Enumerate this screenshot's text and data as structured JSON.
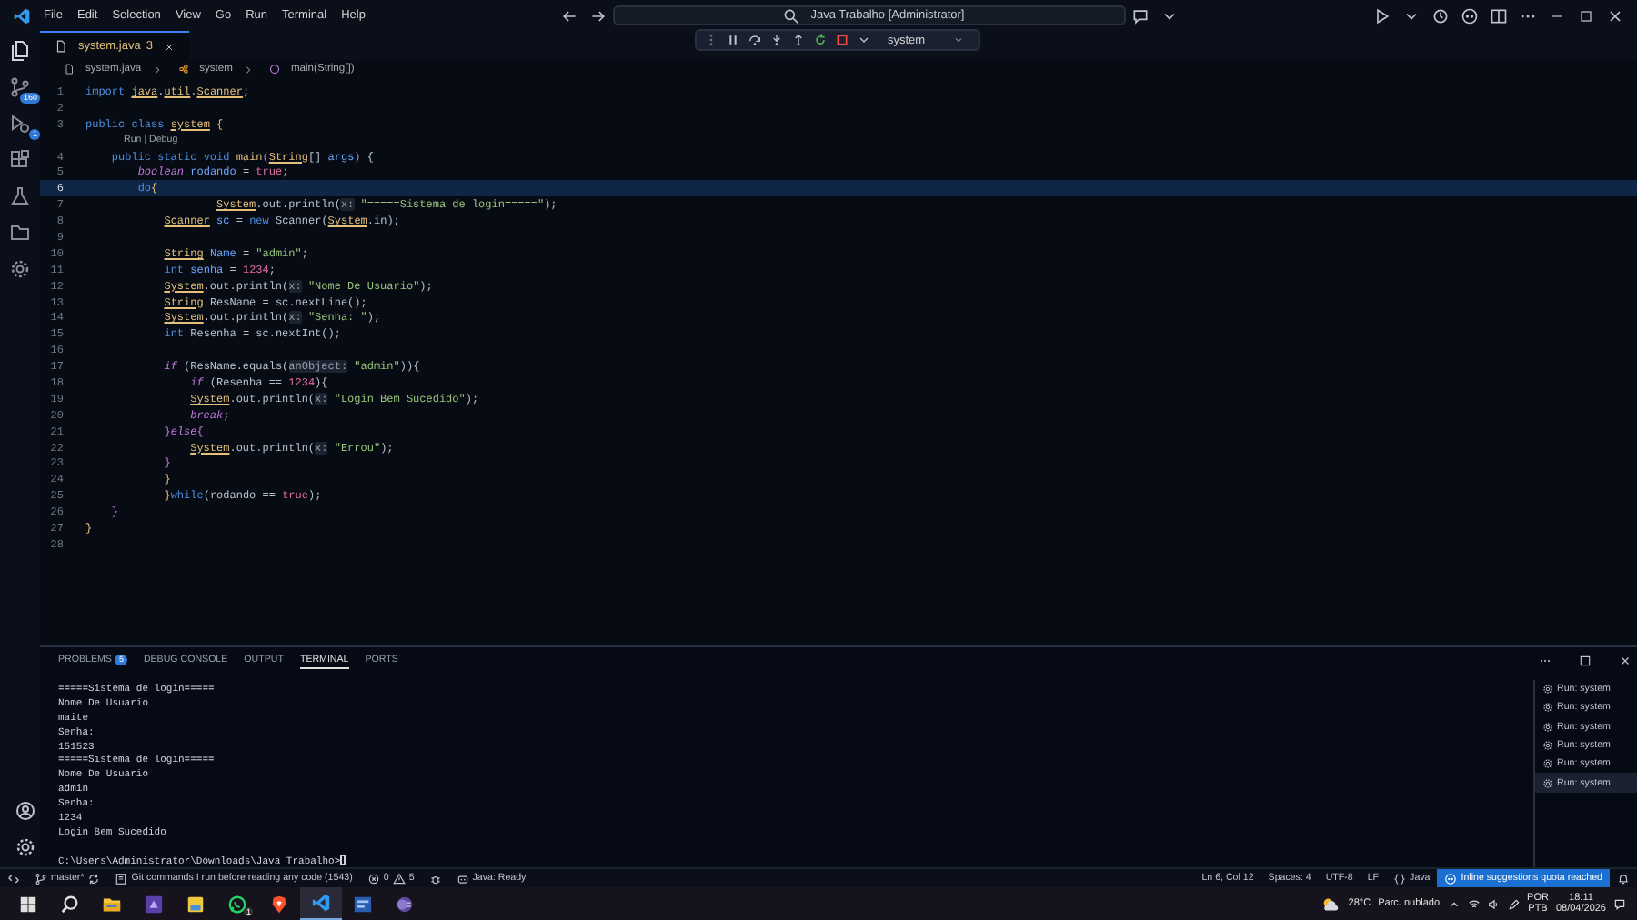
{
  "title_bar": {
    "menu": [
      "File",
      "Edit",
      "Selection",
      "View",
      "Go",
      "Run",
      "Terminal",
      "Help"
    ],
    "search": "Java Trabalho [Administrator]"
  },
  "debug_toolbar": {
    "config": "system"
  },
  "tabs": [
    {
      "label": "system.java",
      "badge": "3",
      "selected": true
    }
  ],
  "breadcrumb": [
    "system.java",
    "system",
    "main(String[])"
  ],
  "editor": {
    "lines": [
      {
        "kind": "code",
        "number": "1",
        "current": false,
        "tokens": [
          {
            "kind": "keyword",
            "text": "import"
          },
          {
            "kind": "class",
            "text": " java"
          },
          {
            "kind": "plain",
            "text": "."
          },
          {
            "kind": "class",
            "text": "util"
          },
          {
            "kind": "plain",
            "text": "."
          },
          {
            "kind": "class",
            "text": "Scanner"
          },
          {
            "kind": "plain",
            "text": ";"
          }
        ]
      },
      {
        "kind": "code",
        "number": "2",
        "current": false
      },
      {
        "kind": "code",
        "number": "3",
        "current": false,
        "tokens": [
          {
            "kind": "keyword",
            "text": "public class"
          },
          {
            "kind": "class",
            "text": " system"
          },
          {
            "kind": "brace",
            "text": " {"
          }
        ]
      },
      {
        "kind": "lens",
        "text": "Run | Debug"
      },
      {
        "kind": "code",
        "number": "4",
        "current": false,
        "tokens": [
          {
            "kind": "keyword",
            "text": "    public static void"
          },
          {
            "kind": "function",
            "text": " main"
          },
          {
            "kind": "brace2",
            "text": "("
          },
          {
            "kind": "class",
            "text": "String"
          },
          {
            "kind": "plain",
            "text": "[]"
          },
          {
            "kind": "variable",
            "text": " args"
          },
          {
            "kind": "brace2",
            "text": ")"
          },
          {
            "kind": "plain",
            "text": " {"
          }
        ]
      },
      {
        "kind": "code",
        "number": "5",
        "current": false,
        "tokens": [
          {
            "kind": "control",
            "text": "        boolean"
          },
          {
            "kind": "variable",
            "text": " rodando"
          },
          {
            "kind": "plain",
            "text": " = "
          },
          {
            "kind": "literal",
            "text": "true"
          },
          {
            "kind": "plain",
            "text": ";"
          }
        ]
      },
      {
        "kind": "code",
        "number": "6",
        "current": true,
        "tokens": [
          {
            "kind": "keyword",
            "text": "        do"
          },
          {
            "kind": "brace",
            "text": "{"
          }
        ]
      },
      {
        "kind": "code",
        "number": "7",
        "current": false,
        "tokens": [
          {
            "kind": "class",
            "text": "                    System"
          },
          {
            "kind": "plain",
            "text": ".out.println("
          },
          {
            "kind": "hint",
            "text": "x:"
          },
          {
            "kind": "string",
            "text": " \"=====Sistema de login=====\""
          },
          {
            "kind": "plain",
            "text": ");"
          }
        ]
      },
      {
        "kind": "code",
        "number": "8",
        "current": false,
        "tokens": [
          {
            "kind": "class",
            "text": "            Scanner"
          },
          {
            "kind": "variable",
            "text": " sc"
          },
          {
            "kind": "plain",
            "text": " = "
          },
          {
            "kind": "keyword",
            "text": "new"
          },
          {
            "kind": "plain",
            "text": " Scanner("
          },
          {
            "kind": "class",
            "text": "System"
          },
          {
            "kind": "plain",
            "text": ".in);"
          }
        ]
      },
      {
        "kind": "code",
        "number": "9",
        "current": false
      },
      {
        "kind": "code",
        "number": "10",
        "current": false,
        "tokens": [
          {
            "kind": "class",
            "text": "            String"
          },
          {
            "kind": "variable",
            "text": " Name"
          },
          {
            "kind": "plain",
            "text": " = "
          },
          {
            "kind": "string",
            "text": "\"admin\""
          },
          {
            "kind": "plain",
            "text": ";"
          }
        ]
      },
      {
        "kind": "code",
        "number": "11",
        "current": false,
        "tokens": [
          {
            "kind": "keyword",
            "text": "            int"
          },
          {
            "kind": "variable",
            "text": " senha"
          },
          {
            "kind": "plain",
            "text": " = "
          },
          {
            "kind": "number",
            "text": "1234"
          },
          {
            "kind": "plain",
            "text": ";"
          }
        ]
      },
      {
        "kind": "code",
        "number": "12",
        "current": false,
        "tokens": [
          {
            "kind": "class",
            "text": "            System"
          },
          {
            "kind": "plain",
            "text": ".out.println("
          },
          {
            "kind": "hint",
            "text": "x:"
          },
          {
            "kind": "string",
            "text": " \"Nome De Usuario\""
          },
          {
            "kind": "plain",
            "text": ");"
          }
        ]
      },
      {
        "kind": "code",
        "number": "13",
        "current": false,
        "tokens": [
          {
            "kind": "class",
            "text": "            String"
          },
          {
            "kind": "plain",
            "text": " ResName = sc.nextLine();"
          }
        ]
      },
      {
        "kind": "code",
        "number": "14",
        "current": false,
        "tokens": [
          {
            "kind": "class",
            "text": "            System"
          },
          {
            "kind": "plain",
            "text": ".out.println("
          },
          {
            "kind": "hint",
            "text": "x:"
          },
          {
            "kind": "string",
            "text": " \"Senha: \""
          },
          {
            "kind": "plain",
            "text": ");"
          }
        ]
      },
      {
        "kind": "code",
        "number": "15",
        "current": false,
        "tokens": [
          {
            "kind": "keyword",
            "text": "            int"
          },
          {
            "kind": "plain",
            "text": " Resenha = sc.nextInt();"
          }
        ]
      },
      {
        "kind": "code",
        "number": "16",
        "current": false
      },
      {
        "kind": "code",
        "number": "17",
        "current": false,
        "tokens": [
          {
            "kind": "control",
            "text": "            if"
          },
          {
            "kind": "plain",
            "text": " (ResName.equals("
          },
          {
            "kind": "hint",
            "text": "anObject:"
          },
          {
            "kind": "string",
            "text": " \"admin\""
          },
          {
            "kind": "plain",
            "text": ")){"
          }
        ]
      },
      {
        "kind": "code",
        "number": "18",
        "current": false,
        "tokens": [
          {
            "kind": "control",
            "text": "                if"
          },
          {
            "kind": "plain",
            "text": " (Resenha == "
          },
          {
            "kind": "number",
            "text": "1234"
          },
          {
            "kind": "plain",
            "text": "){"
          }
        ]
      },
      {
        "kind": "code",
        "number": "19",
        "current": false,
        "tokens": [
          {
            "kind": "class",
            "text": "                System"
          },
          {
            "kind": "plain",
            "text": ".out.println("
          },
          {
            "kind": "hint",
            "text": "x:"
          },
          {
            "kind": "string",
            "text": " \"Login Bem Sucedido\""
          },
          {
            "kind": "plain",
            "text": ");"
          }
        ]
      },
      {
        "kind": "code",
        "number": "20",
        "current": false,
        "tokens": [
          {
            "kind": "control",
            "text": "                break"
          },
          {
            "kind": "plain",
            "text": ";"
          }
        ]
      },
      {
        "kind": "code",
        "number": "21",
        "current": false,
        "tokens": [
          {
            "kind": "brace2",
            "text": "            }"
          },
          {
            "kind": "control",
            "text": "else"
          },
          {
            "kind": "brace2",
            "text": "{"
          }
        ]
      },
      {
        "kind": "code",
        "number": "22",
        "current": false,
        "tokens": [
          {
            "kind": "class",
            "text": "                System"
          },
          {
            "kind": "plain",
            "text": ".out.println("
          },
          {
            "kind": "hint",
            "text": "x:"
          },
          {
            "kind": "string",
            "text": " \"Errou\""
          },
          {
            "kind": "plain",
            "text": ");"
          }
        ]
      },
      {
        "kind": "code",
        "number": "23",
        "current": false,
        "tokens": [
          {
            "kind": "brace2",
            "text": "            }"
          }
        ]
      },
      {
        "kind": "code",
        "number": "24",
        "current": false,
        "tokens": [
          {
            "kind": "brace",
            "text": "            }"
          }
        ]
      },
      {
        "kind": "code",
        "number": "25",
        "current": false,
        "tokens": [
          {
            "kind": "brace",
            "text": "            }"
          },
          {
            "kind": "keyword",
            "text": "while"
          },
          {
            "kind": "plain",
            "text": "(rodando == "
          },
          {
            "kind": "literal",
            "text": "true"
          },
          {
            "kind": "plain",
            "text": ");"
          }
        ]
      },
      {
        "kind": "code",
        "number": "26",
        "current": false,
        "tokens": [
          {
            "kind": "brace2",
            "text": "    }"
          }
        ]
      },
      {
        "kind": "code",
        "number": "27",
        "current": false,
        "tokens": [
          {
            "kind": "brace",
            "text": "}"
          }
        ]
      },
      {
        "kind": "code",
        "number": "28",
        "current": false
      }
    ]
  },
  "panel": {
    "tabs": [
      {
        "label": "PROBLEMS",
        "badge": "5",
        "selected": false
      },
      {
        "label": "DEBUG CONSOLE",
        "selected": false
      },
      {
        "label": "OUTPUT",
        "selected": false
      },
      {
        "label": "TERMINAL",
        "selected": true
      },
      {
        "label": "PORTS",
        "selected": false
      }
    ],
    "terminal": [
      "=====Sistema de login=====",
      "Nome De Usuario",
      "maite",
      "Senha:",
      "151523",
      "=====Sistema de login=====",
      "Nome De Usuario",
      "admin",
      "Senha:",
      "1234",
      "Login Bem Sucedido"
    ],
    "prompt": "C:\\Users\\Administrator\\Downloads\\Java Trabalho>",
    "sessions": [
      {
        "label": "Run: system",
        "selected": false
      },
      {
        "label": "Run: system",
        "selected": false
      },
      {
        "label": "Run: system",
        "selected": false
      },
      {
        "label": "Run: system",
        "selected": false
      },
      {
        "label": "Run: system",
        "selected": false
      },
      {
        "label": "Run: system",
        "selected": true
      }
    ]
  },
  "status_bar": {
    "branch": "master*",
    "git_message": "Git commands I run before reading any code (1543)",
    "errors": "0",
    "warnings": "5",
    "java_status": "Java: Ready",
    "right": [
      {
        "kind": "text",
        "text": "Ln 6, Col 12"
      },
      {
        "kind": "text",
        "text": "Spaces: 4"
      },
      {
        "kind": "text",
        "text": "UTF-8"
      },
      {
        "kind": "text",
        "text": "LF"
      },
      {
        "kind": "language",
        "text": "Java"
      },
      {
        "kind": "notice",
        "text": "Inline suggestions quota reached"
      }
    ]
  },
  "activity_bar": [
    {
      "kind": "files"
    },
    {
      "kind": "source-control",
      "badge": "160"
    },
    {
      "kind": "run",
      "badge": "1"
    },
    {
      "kind": "extensions"
    },
    {
      "kind": "testing"
    },
    {
      "kind": "folder"
    },
    {
      "kind": "gear-app"
    }
  ],
  "taskbar": {
    "apps": [
      {
        "kind": "explorer",
        "active": false
      },
      {
        "kind": "purple-app",
        "active": false
      },
      {
        "kind": "notes",
        "active": false
      },
      {
        "kind": "chat",
        "active": false,
        "badge": "1"
      },
      {
        "kind": "browser",
        "active": false
      },
      {
        "kind": "vscode",
        "active": true
      },
      {
        "kind": "blue-app",
        "active": false
      },
      {
        "kind": "eclipse",
        "active": false
      }
    ],
    "weather": {
      "temp": "28°C",
      "text": "Parc. nublado"
    },
    "language": "POR",
    "layout": "PTB",
    "time": "18:11",
    "date": "08/04/2026"
  }
}
